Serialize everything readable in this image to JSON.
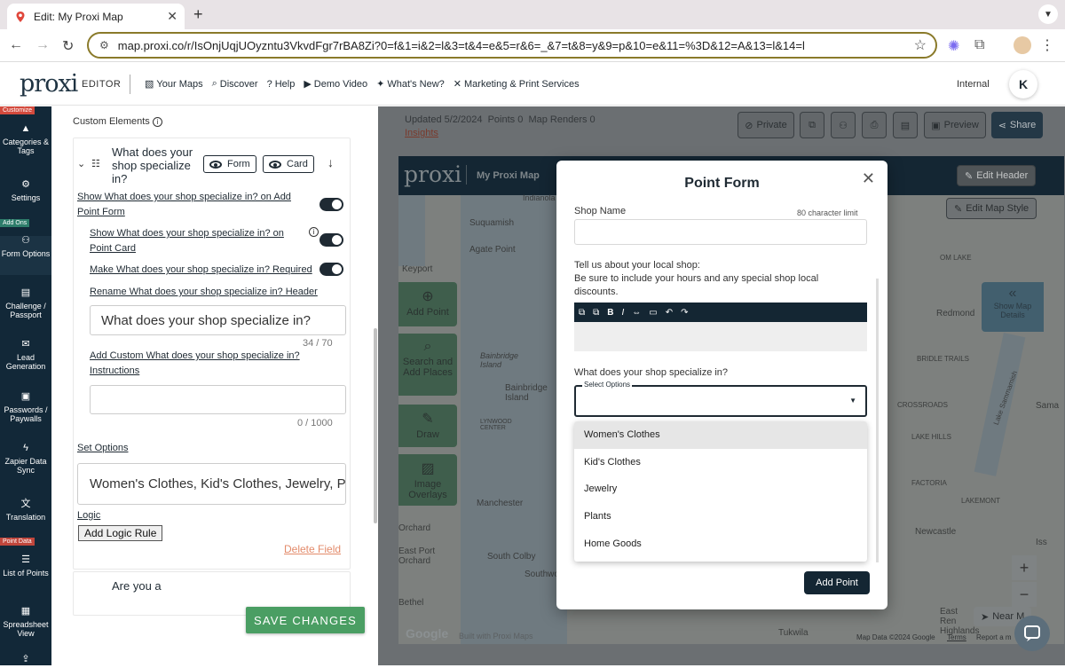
{
  "browser": {
    "tab_title": "Edit: My Proxi Map",
    "tab_close": "✕",
    "new_tab": "+",
    "url": "map.proxi.co/r/IsOnjUqjUOyzntu3VkvdFgr7rBA8Zi?0=f&1=i&2=l&3=t&4=e&5=r&6=_&7=t&8=y&9=p&10=e&11=%3D&12=A&13=l&14=l"
  },
  "header": {
    "logo": "proxi",
    "editor_label": "EDITOR",
    "nav": [
      {
        "icon": "maps-icon",
        "glyph": "▧",
        "label": "Your Maps"
      },
      {
        "icon": "search-icon",
        "glyph": "⌕",
        "label": "Discover"
      },
      {
        "icon": "help-icon",
        "glyph": "?",
        "label": "Help"
      },
      {
        "icon": "video-icon",
        "glyph": "▶",
        "label": "Demo Video"
      },
      {
        "icon": "sparkle-icon",
        "glyph": "✦",
        "label": "What's New?"
      },
      {
        "icon": "tools-icon",
        "glyph": "✕",
        "label": "Marketing & Print Services"
      }
    ],
    "internal_label": "Internal",
    "user_initial": "K"
  },
  "sidebar": {
    "tags": [
      "Customize",
      "Add Ons",
      "Point Data"
    ],
    "items": [
      {
        "icon": "tags-icon",
        "label": "Categories & Tags"
      },
      {
        "icon": "gear-icon",
        "label": "Settings"
      },
      {
        "icon": "form-icon",
        "label": "Form Options"
      },
      {
        "icon": "passport-icon",
        "label": "Challenge / Passport"
      },
      {
        "icon": "mail-icon",
        "label": "Lead Generation"
      },
      {
        "icon": "lock-icon",
        "label": "Passwords / Paywalls"
      },
      {
        "icon": "zap-icon",
        "label": "Zapier Data Sync"
      },
      {
        "icon": "translate-icon",
        "label": "Translation"
      },
      {
        "icon": "list-icon",
        "label": "List of Points"
      },
      {
        "icon": "grid-icon",
        "label": "Spreadsheet View"
      }
    ]
  },
  "panel": {
    "title": "Custom Elements",
    "field_title": "What does your shop specialize in?",
    "form_btn": "Form",
    "card_btn": "Card",
    "show_on_add_form": "Show What does your shop specialize in? on Add Point Form",
    "show_on_card": "Show What does your shop specialize in? on Point Card",
    "make_required": "Make What does your shop specialize in? Required",
    "rename_header": "Rename What does your shop specialize in? Header",
    "header_value": "What does your shop specialize in?",
    "header_count": "34 / 70",
    "instructions_label": "Add Custom What does your shop specialize in? Instructions",
    "instructions_value": "",
    "instructions_count": "0 / 1000",
    "set_options": "Set Options",
    "options_value": "Women's Clothes, Kid's Clothes, Jewelry, Plants, Home Goods",
    "logic": "Logic",
    "add_logic_rule": "Add Logic Rule",
    "delete_field": "Delete Field",
    "next_field": "Are you a",
    "save_changes": "SAVE CHANGES"
  },
  "map": {
    "updated": "Updated 5/2/2024",
    "points": "Points 0",
    "renders": "Map Renders 0",
    "insights": "Insights",
    "private": "Private",
    "preview": "Preview",
    "share": "Share",
    "logo": "proxi",
    "map_name": "My Proxi Map",
    "edit_header": "Edit Header",
    "edit_style": "Edit Map Style",
    "show_details": "Show Map Details",
    "tools": [
      "Add Point",
      "Search and Add Places",
      "Draw",
      "Image Overlays"
    ],
    "places": [
      "Indianola",
      "Suquamish",
      "Agate Point",
      "Keyport",
      "Bainbridge Island",
      "Bainbridge Island",
      "LYNWOOD CENTER",
      "Manchester",
      "South Colby",
      "East Port Orchard",
      "Orchard",
      "Southworth",
      "Bethel",
      "Redmond",
      "BRIDLE TRAILS",
      "LAKE HILLS",
      "CROSSROADS",
      "Lake Sammamish",
      "Sama",
      "FACTORIA",
      "LAKEMONT",
      "Newcastle",
      "Iss",
      "East Ren Highlands",
      "Tukwila",
      "Near M",
      "OM LAKE"
    ],
    "attribution": "Built with Proxi Maps",
    "map_data": "Map Data ©2024 Google",
    "terms": "Terms",
    "report": "Report a m",
    "google": "Google"
  },
  "modal": {
    "title": "Point Form",
    "close": "✕",
    "shop_name_label": "Shop Name",
    "char_limit": "80 character limit",
    "shop_name_value": "",
    "about_label": "Tell us about your local shop:",
    "about_hint": "Be sure to include your hours and any special shop local discounts.",
    "rte_tools": [
      "⧉",
      "⧉",
      "B",
      "I",
      "⇔",
      "▭",
      "↶",
      "↷"
    ],
    "specialize_label": "What does your shop specialize in?",
    "select_legend": "Select Options",
    "options": [
      "Women's Clothes",
      "Kid's Clothes",
      "Jewelry",
      "Plants",
      "Home Goods"
    ],
    "add_point": "Add Point"
  }
}
